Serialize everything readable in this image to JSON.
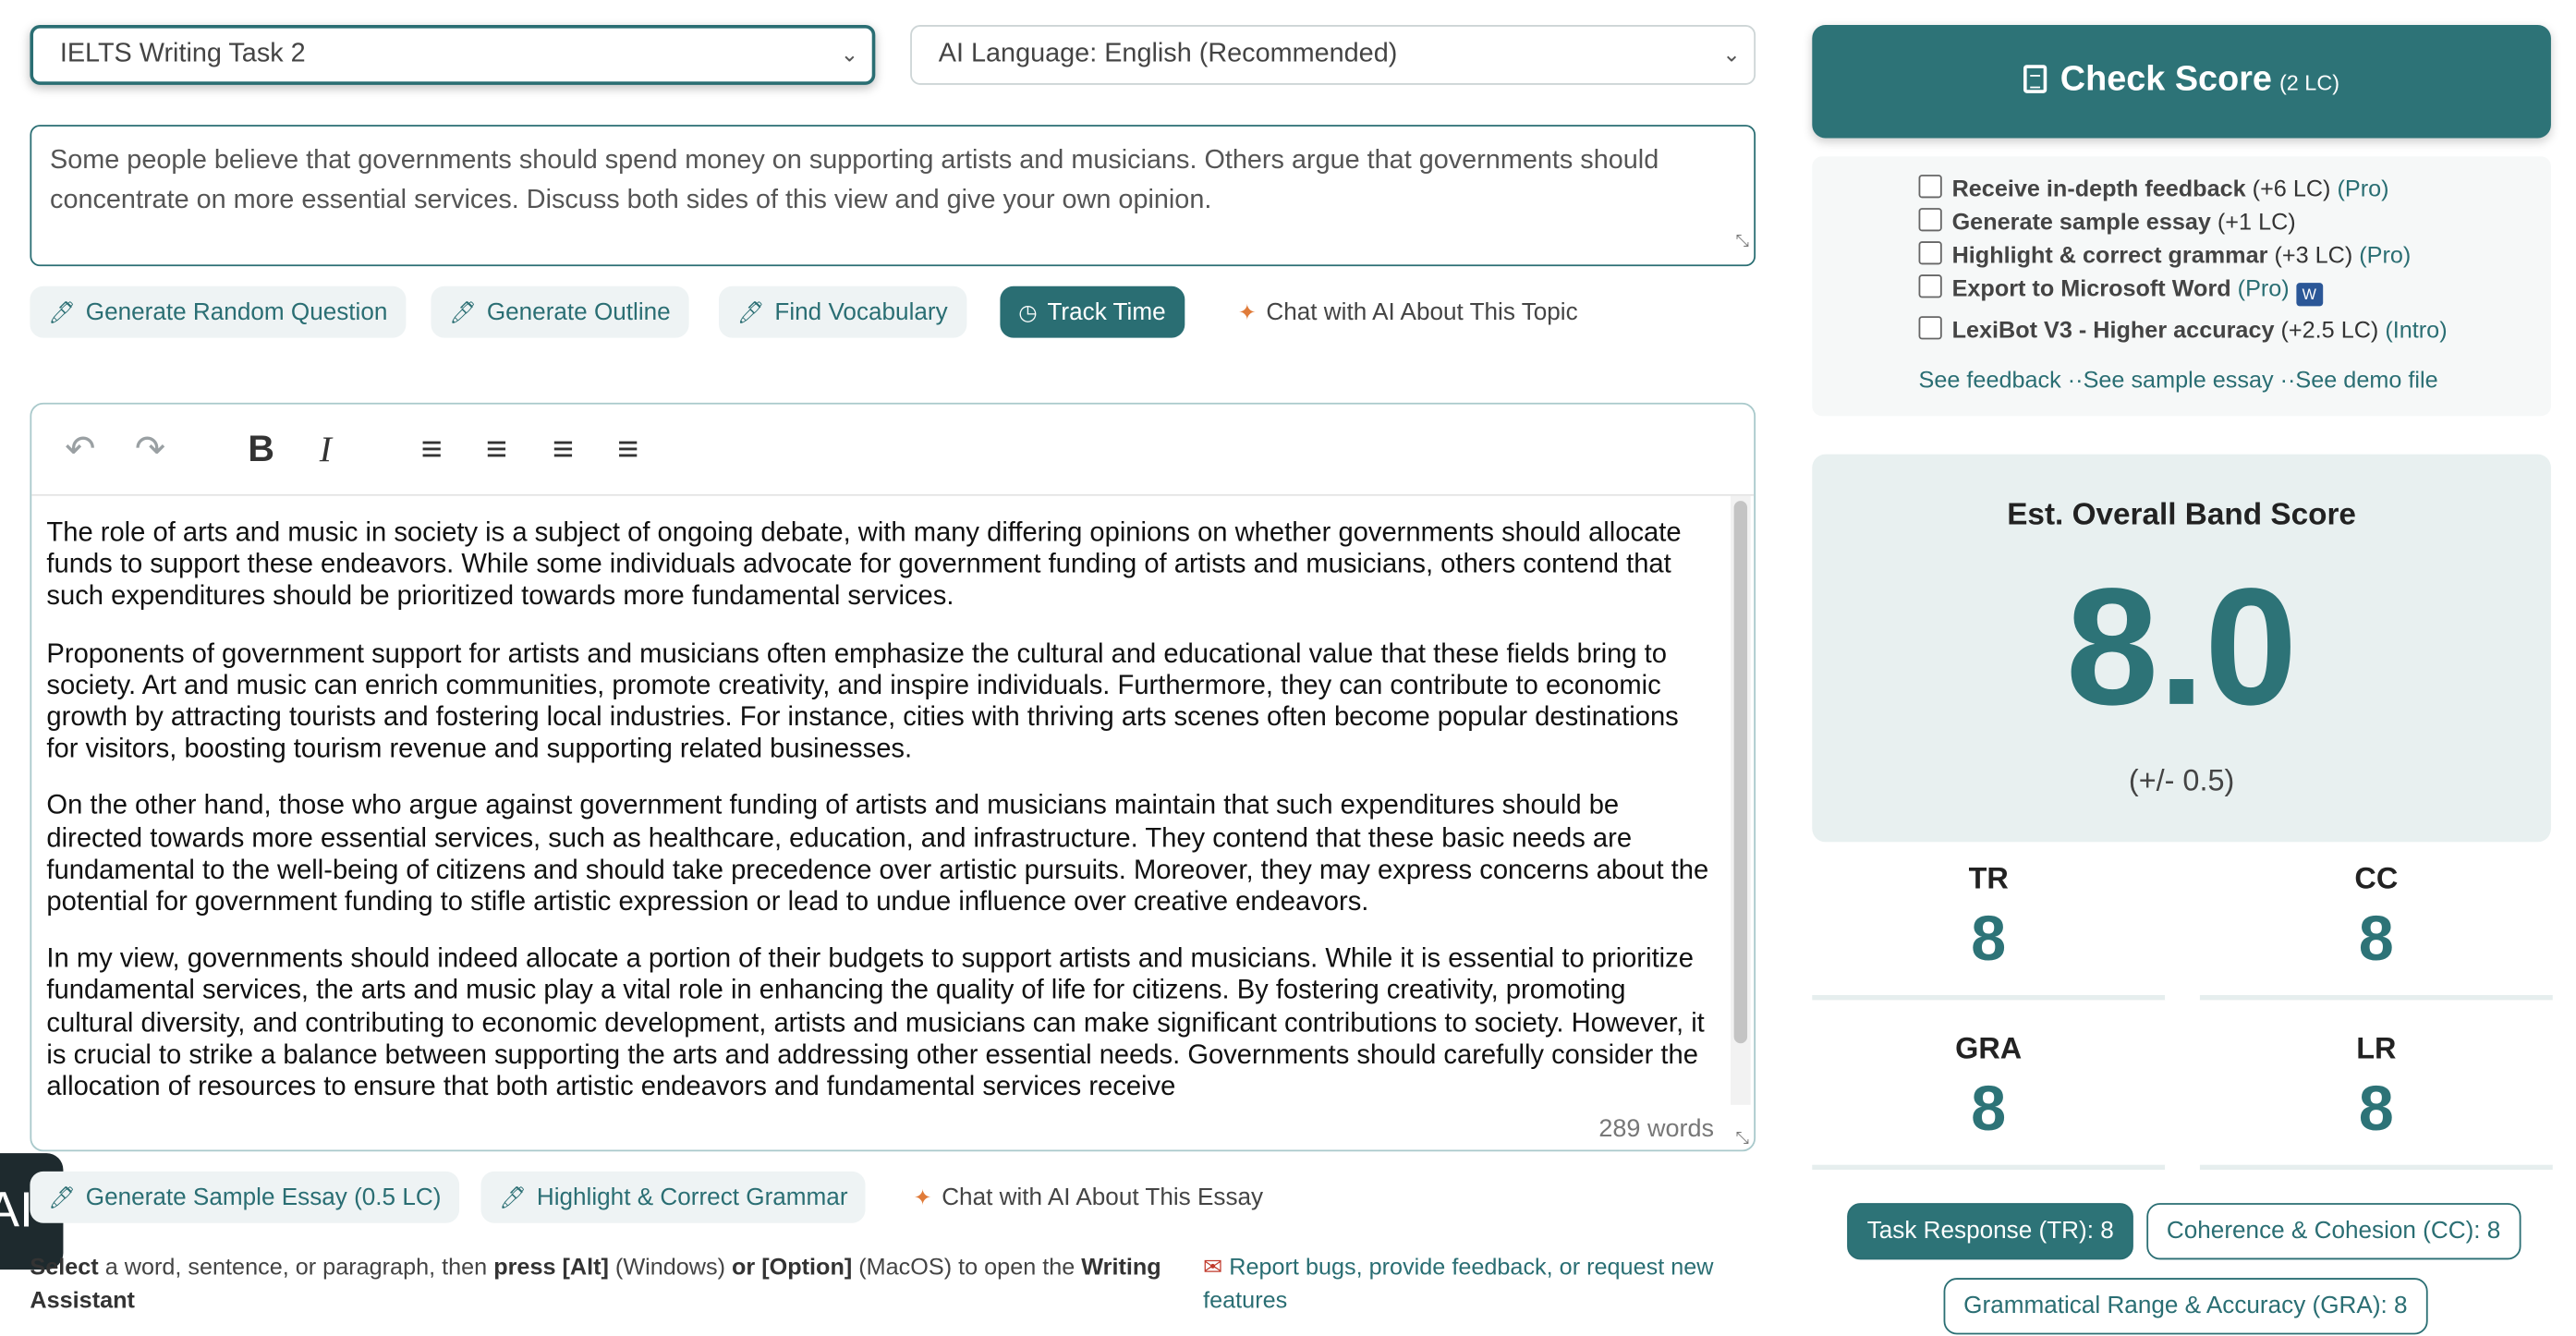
{
  "controls": {
    "task_select": "IELTS Writing Task 2",
    "language_select": "AI Language: English (Recommended)"
  },
  "prompt_text": "Some people believe that governments should spend money on supporting artists and musicians. Others argue that governments should concentrate on more essential services. Discuss both sides of this view and give your own opinion.",
  "tools": {
    "random_question": "Generate Random Question",
    "outline": "Generate Outline",
    "vocabulary": "Find Vocabulary",
    "track_time": "Track Time",
    "chat_topic": "Chat with AI About This Topic"
  },
  "editor": {
    "toolbar": {
      "undo": "↶",
      "redo": "↷",
      "bold": "B",
      "italic": "I",
      "align_left": "≡",
      "align_center": "≡",
      "align_right": "≡",
      "justify": "≡"
    },
    "paragraphs": [
      "The role of arts and music in society is a subject of ongoing debate, with many differing opinions on whether governments should allocate funds to support these endeavors. While some individuals advocate for government funding of artists and musicians, others contend that such expenditures should be prioritized towards more fundamental services.",
      "Proponents of government support for artists and musicians often emphasize the cultural and educational value that these fields bring to society. Art and music can enrich communities, promote creativity, and inspire individuals. Furthermore, they can contribute to economic growth by attracting tourists and fostering local industries. For instance, cities with thriving arts scenes often become popular destinations for visitors, boosting tourism revenue and supporting related businesses.",
      "On the other hand, those who argue against government funding of artists and musicians maintain that such expenditures should be directed towards more essential services, such as healthcare, education, and infrastructure. They contend that these basic needs are fundamental to the well-being of citizens and should take precedence over artistic pursuits. Moreover, they may express concerns about the potential for government funding to stifle artistic expression or lead to undue influence over creative endeavors.",
      "In my view, governments should indeed allocate a portion of their budgets to support artists and musicians. While it is essential to prioritize fundamental services, the arts and music play a vital role in enhancing the quality of life for citizens. By fostering creativity, promoting cultural diversity, and contributing to economic development, artists and musicians can make significant contributions to society. However, it is crucial to strike a balance between supporting the arts and addressing other essential needs. Governments should carefully consider the allocation of resources to ensure that both artistic endeavors and fundamental services receive"
    ],
    "word_count": "289 words"
  },
  "bottom": {
    "sample_essay": "Generate Sample Essay (0.5 LC)",
    "highlight_grammar": "Highlight & Correct Grammar",
    "chat_essay": "Chat with AI About This Essay",
    "ai_badge": "AI",
    "helper": {
      "select": "Select",
      "t1": " a word, sentence, or paragraph, then ",
      "press_alt": "press [Alt]",
      "t2": " (Windows) ",
      "or_option": "or [Option]",
      "t3": " (MacOS) to open the ",
      "assistant": "Writing Assistant"
    },
    "report_link": "Report bugs, provide feedback, or request new features"
  },
  "score_panel": {
    "check_title": "Check Score",
    "check_cost": "(2 LC)",
    "options": [
      {
        "label": "Receive in-depth feedback",
        "cost": " (+6 LC) ",
        "tag": "(Pro)"
      },
      {
        "label": "Generate sample essay",
        "cost": " (+1 LC)",
        "tag": ""
      },
      {
        "label": "Highlight & correct grammar",
        "cost": " (+3 LC) ",
        "tag": "(Pro)"
      },
      {
        "label": "Export to Microsoft Word",
        "cost": " ",
        "tag": "(Pro)"
      },
      {
        "label": "LexiBot V3 - Higher accuracy",
        "cost": " (+2.5 LC) ",
        "tag": "(Intro)"
      }
    ],
    "links": {
      "feedback": "See feedback",
      "sample": "See sample essay",
      "demo": "See demo file"
    },
    "overall": {
      "heading": "Est. Overall Band Score",
      "value": "8.0",
      "margin": "(+/- 0.5)"
    },
    "criteria": [
      {
        "abbr": "TR",
        "score": "8"
      },
      {
        "abbr": "CC",
        "score": "8"
      },
      {
        "abbr": "GRA",
        "score": "8"
      },
      {
        "abbr": "LR",
        "score": "8"
      }
    ],
    "pills": {
      "tr": "Task Response (TR): 8",
      "cc": "Coherence & Cohesion (CC): 8",
      "gra": "Grammatical Range & Accuracy (GRA): 8"
    }
  }
}
